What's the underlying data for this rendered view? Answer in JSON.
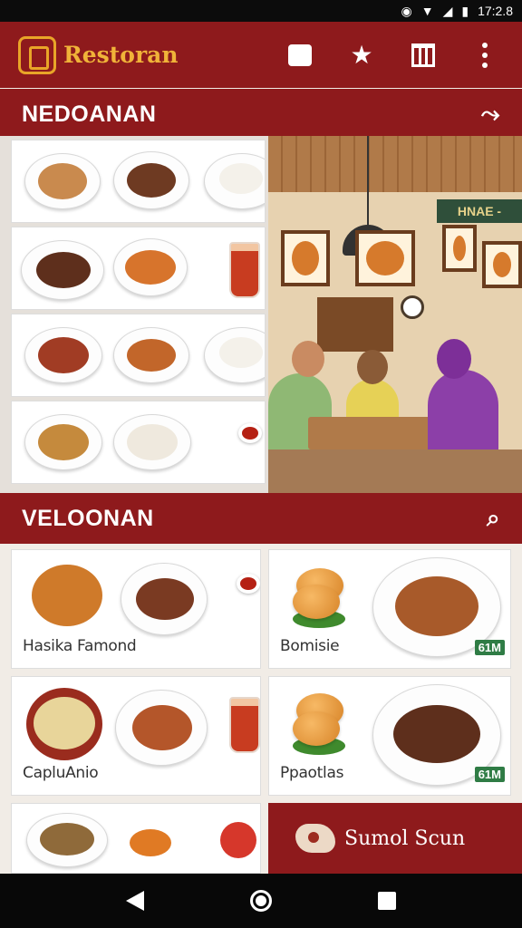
{
  "status_bar": {
    "time": "17:2.8",
    "icons": [
      "sync-icon",
      "wifi-icon",
      "signal-icon",
      "battery-icon"
    ]
  },
  "app_bar": {
    "title": "Restoran",
    "actions": [
      "square-icon",
      "star-icon",
      "book-icon",
      "more-vert-icon"
    ]
  },
  "section_top": {
    "title": "NEDOANAN",
    "icon": "swap-icon"
  },
  "scene": {
    "sign_text": "HNAE -"
  },
  "section_bottom": {
    "title": "VELOONAN",
    "icon": "search-icon"
  },
  "cards": [
    {
      "label": "Hasika Famond"
    },
    {
      "label": "Bomisie",
      "badge": "61M"
    },
    {
      "label": "CapluAnio"
    },
    {
      "label": "Ppaotlas",
      "badge": "61M"
    }
  ],
  "promo": {
    "label": "Sumol Scun"
  },
  "colors": {
    "brand": "#8e1a1c",
    "accent": "#f0b339",
    "badge": "#2f7c45"
  }
}
